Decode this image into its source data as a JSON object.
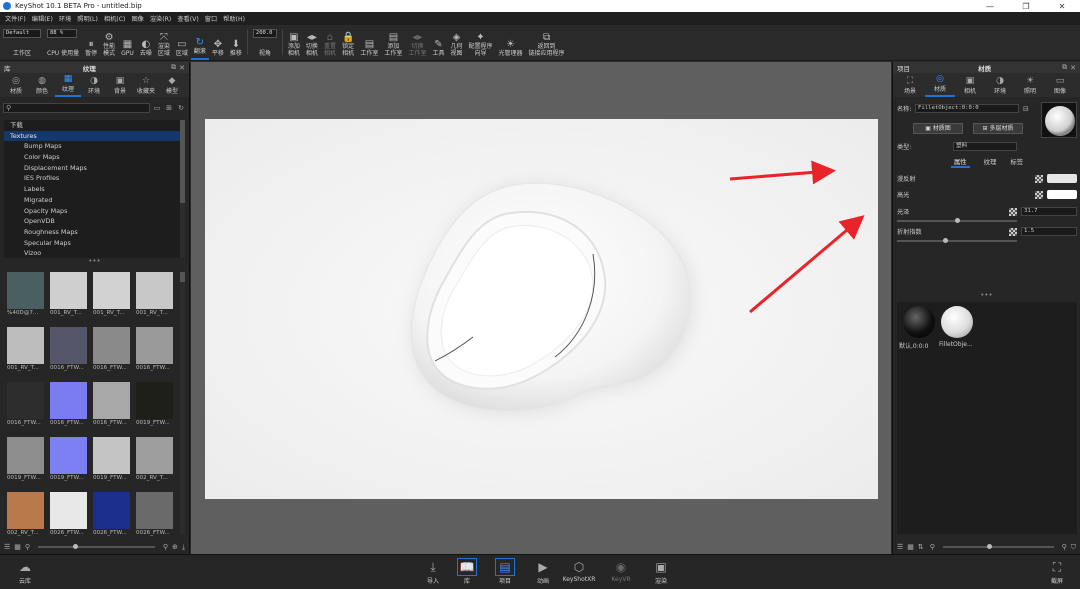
{
  "window": {
    "title": "KeyShot 10.1 BETA Pro  -  untitled.bip",
    "controls": [
      "—",
      "❐",
      "✕"
    ]
  },
  "menubar": [
    "文件(F)",
    "编辑(E)",
    "环境",
    "照明(L)",
    "相机(C)",
    "图像",
    "渲染(R)",
    "查看(V)",
    "窗口",
    "帮助(H)"
  ],
  "toolbar": {
    "workspace_value": "Default",
    "workspace_label": "工作区",
    "cpu_value": "88 %",
    "cpu_label": "CPU 使用量",
    "items": [
      {
        "icon": "⏸",
        "label": "暂停"
      },
      {
        "icon": "⚙",
        "label": "性能\n模式"
      },
      {
        "icon": "▦",
        "label": "GPU"
      },
      {
        "icon": "◐",
        "label": "去噪"
      },
      {
        "icon": "⤧",
        "label": "渲染\n区域"
      },
      {
        "icon": "▭",
        "label": "区域"
      },
      {
        "icon": "↻",
        "label": "翻滚",
        "active": true
      },
      {
        "icon": "✥",
        "label": "平移"
      },
      {
        "icon": "⬇",
        "label": "推移"
      }
    ],
    "fov_value": "200.0",
    "fov_label": "视角",
    "items2": [
      {
        "icon": "▣",
        "label": "添加\n相机"
      },
      {
        "icon": "◂▸",
        "label": "切换\n相机"
      },
      {
        "icon": "⌂",
        "label": "重置\n相机",
        "dim": true
      },
      {
        "icon": "🔒",
        "label": "锁定\n相机"
      },
      {
        "icon": "▤",
        "label": "工作室"
      },
      {
        "icon": "▤",
        "label": "添加\n工作室"
      },
      {
        "icon": "◂▸",
        "label": "切换\n工作室",
        "dim": true
      },
      {
        "icon": "✎",
        "label": "工具"
      },
      {
        "icon": "◈",
        "label": "几何\n视图"
      },
      {
        "icon": "✦",
        "label": "配置程序\n向导"
      },
      {
        "icon": "☀",
        "label": "光管理器"
      },
      {
        "icon": "⧉",
        "label": "返回到\n链接应用程序"
      }
    ]
  },
  "library": {
    "panel_left": "库",
    "panel_title": "纹理",
    "tabs": [
      {
        "icon": "◎",
        "label": "材质"
      },
      {
        "icon": "◍",
        "label": "颜色"
      },
      {
        "icon": "▦",
        "label": "纹理",
        "active": true
      },
      {
        "icon": "◑",
        "label": "环境"
      },
      {
        "icon": "▣",
        "label": "背景"
      },
      {
        "icon": "☆",
        "label": "收藏夹"
      },
      {
        "icon": "◆",
        "label": "模型"
      }
    ],
    "tree": [
      {
        "label": "下载",
        "child": false
      },
      {
        "label": "Textures",
        "child": false,
        "selected": true
      },
      {
        "label": "Bump Maps",
        "child": true
      },
      {
        "label": "Color Maps",
        "child": true
      },
      {
        "label": "Displacement Maps",
        "child": true
      },
      {
        "label": "IES Profiles",
        "child": true
      },
      {
        "label": "Labels",
        "child": true
      },
      {
        "label": "Migrated",
        "child": true
      },
      {
        "label": "Opacity Maps",
        "child": true
      },
      {
        "label": "OpenVDB",
        "child": true
      },
      {
        "label": "Roughness Maps",
        "child": true
      },
      {
        "label": "Specular Maps",
        "child": true
      },
      {
        "label": "Vizoo",
        "child": true
      }
    ],
    "thumbnails": [
      {
        "label": "%40D@7...",
        "color": "#4a6060"
      },
      {
        "label": "001_RV_T...",
        "color": "#cfcfcf"
      },
      {
        "label": "001_RV_T...",
        "color": "#d2d2d2"
      },
      {
        "label": "001_RV_T...",
        "color": "#c8c8c8"
      },
      {
        "label": "001_RV_T...",
        "color": "#bdbdbd"
      },
      {
        "label": "0016_FTW...",
        "color": "#55556a"
      },
      {
        "label": "0016_FTW...",
        "color": "#8a8a8a"
      },
      {
        "label": "0016_FTW...",
        "color": "#9a9a9a"
      },
      {
        "label": "0016_FTW...",
        "color": "#2d2d2d"
      },
      {
        "label": "0016_FTW...",
        "color": "#7b7cf0"
      },
      {
        "label": "0016_FTW...",
        "color": "#a8a8a8"
      },
      {
        "label": "0019_FTW...",
        "color": "#1f1f1a"
      },
      {
        "label": "0019_FTW...",
        "color": "#8d8d8d"
      },
      {
        "label": "0019_FTW...",
        "color": "#7d80f2"
      },
      {
        "label": "0019_FTW...",
        "color": "#c4c4c4"
      },
      {
        "label": "002_RV_T...",
        "color": "#9e9e9e"
      },
      {
        "label": "002_RV_T...",
        "color": "#b9794a"
      },
      {
        "label": "0026_FTW...",
        "color": "#e8e8e8"
      },
      {
        "label": "0026_FTW...",
        "color": "#1b2f8a"
      },
      {
        "label": "0026_FTW...",
        "color": "#6a6a6a"
      },
      {
        "label": "",
        "color": "#6f6ff0"
      },
      {
        "label": "",
        "color": "#b0b0b0"
      },
      {
        "label": "",
        "color": "#335a88"
      },
      {
        "label": "",
        "color": "#8a8a8a"
      }
    ]
  },
  "project": {
    "panel_left": "项目",
    "panel_title": "材质",
    "tabs": [
      {
        "icon": "⛶",
        "label": "场景"
      },
      {
        "icon": "◎",
        "label": "材质",
        "active": true
      },
      {
        "icon": "▣",
        "label": "相机"
      },
      {
        "icon": "◑",
        "label": "环境"
      },
      {
        "icon": "☀",
        "label": "照明"
      },
      {
        "icon": "▭",
        "label": "图像"
      }
    ],
    "name_label": "名称:",
    "name_value": "FilletObject:0:0:0",
    "material_graph_btn": "材质图",
    "multi_material_btn": "多层材质",
    "type_label": "类型:",
    "type_value": "塑料",
    "subtabs": [
      "属性",
      "纹理",
      "标签"
    ],
    "props": [
      {
        "label": "漫反射",
        "kind": "swatch"
      },
      {
        "label": "高光",
        "kind": "swatch-white"
      },
      {
        "label": "光泽",
        "kind": "value",
        "value": "31.7",
        "level": 0.48
      },
      {
        "label": "折射指数",
        "kind": "value",
        "value": "1.5",
        "level": 0.38
      }
    ],
    "materials": [
      {
        "label": "默认,0:0:0"
      },
      {
        "label": "FilletObje..."
      }
    ]
  },
  "ribbon": {
    "left_label": "云库",
    "items": [
      {
        "icon": "⤓",
        "label": "导入"
      },
      {
        "icon": "📖",
        "label": "库",
        "active": true
      },
      {
        "icon": "▤",
        "label": "项目",
        "active": true
      },
      {
        "icon": "▶",
        "label": "动画"
      },
      {
        "icon": "⬡",
        "label": "KeyShotXR"
      },
      {
        "icon": "◉",
        "label": "KeyVR",
        "dim": true
      },
      {
        "icon": "▣",
        "label": "渲染"
      }
    ],
    "right_label": "截屏"
  }
}
